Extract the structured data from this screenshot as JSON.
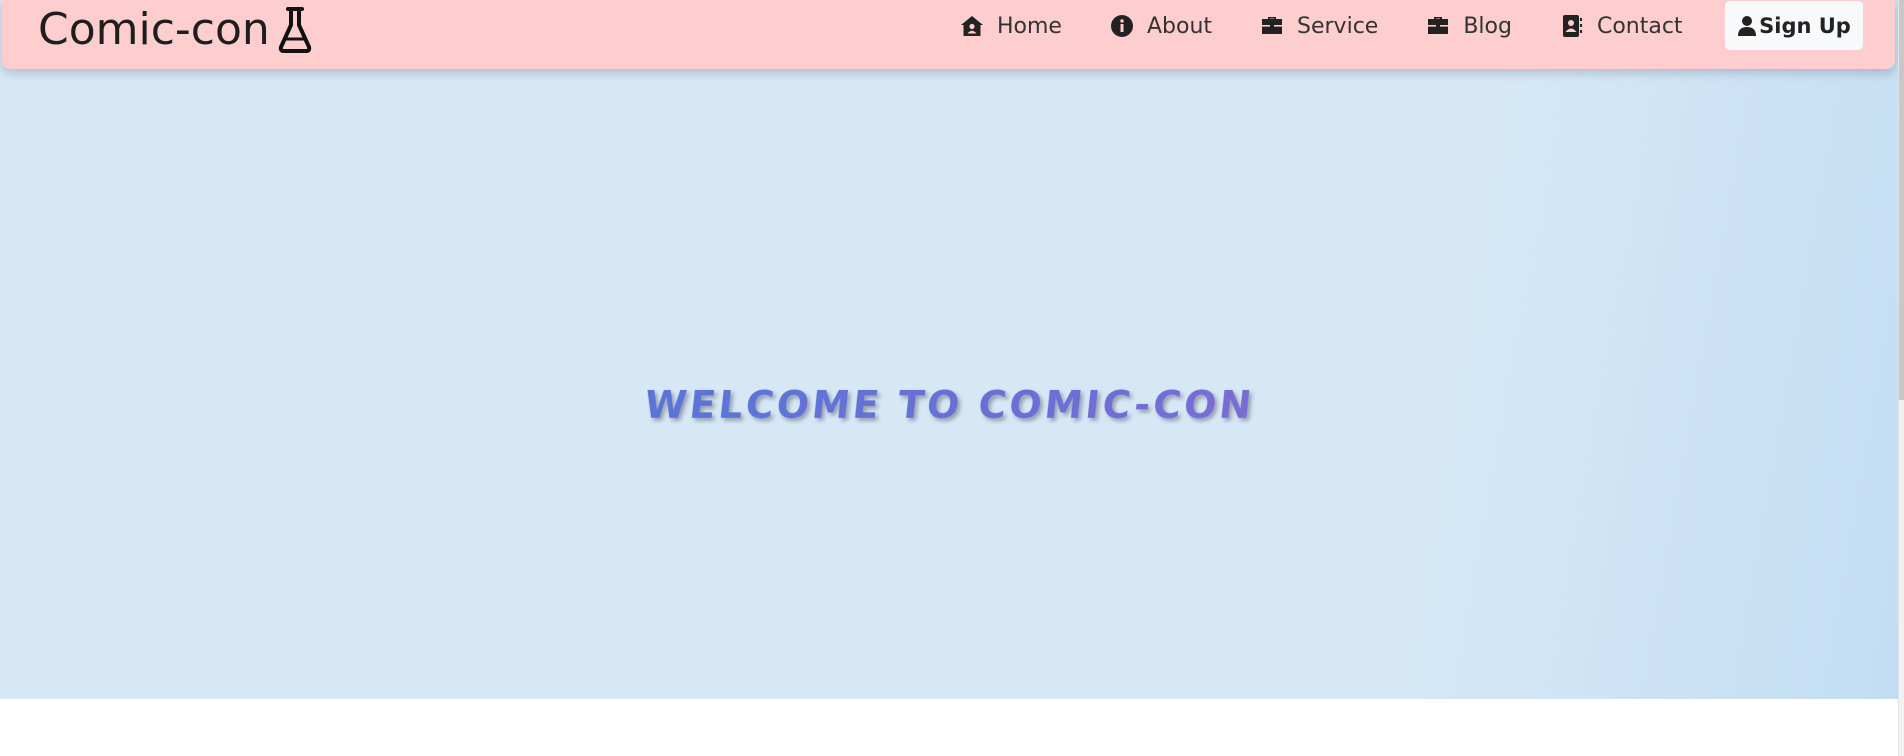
{
  "navbar": {
    "brand": "Comic-con",
    "brand_icon": "flask-icon",
    "items": [
      {
        "label": "Home",
        "icon": "house-user-icon"
      },
      {
        "label": "About",
        "icon": "info-circle-icon"
      },
      {
        "label": "Service",
        "icon": "briefcase-icon"
      },
      {
        "label": "Blog",
        "icon": "briefcase-icon"
      },
      {
        "label": "Contact",
        "icon": "address-book-icon"
      }
    ],
    "signup": {
      "label": "Sign Up",
      "icon": "user-icon"
    },
    "background": "#fecdcd"
  },
  "hero": {
    "title": "WELCOME TO COMIC-CON",
    "background": "#d6e8f6",
    "title_gradient": [
      "#3f7fd8",
      "#a763d9"
    ]
  }
}
